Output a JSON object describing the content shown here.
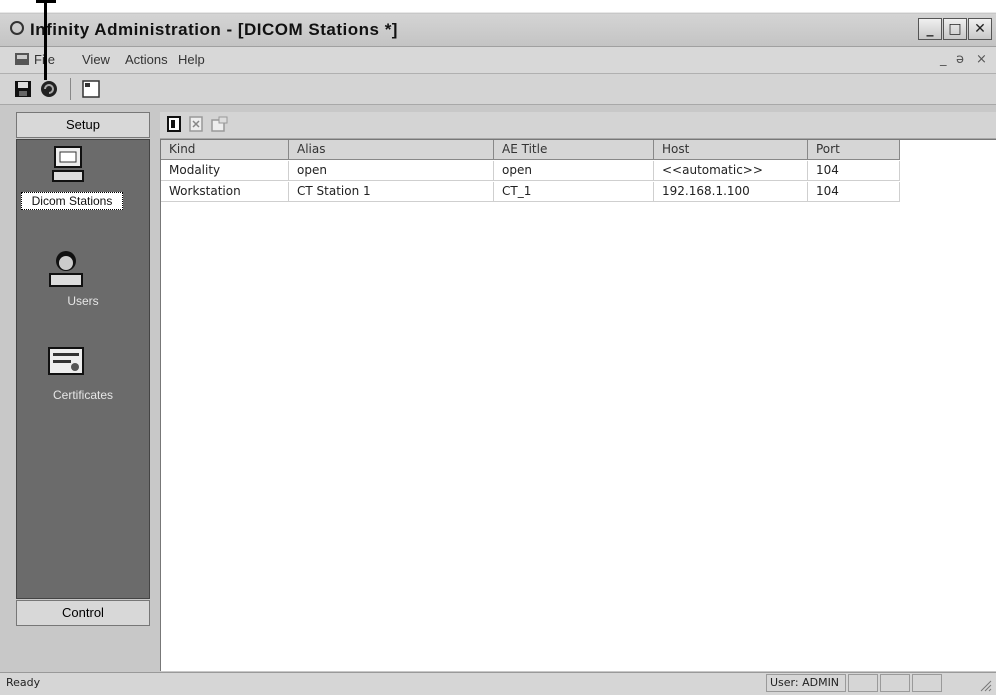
{
  "window": {
    "title": "Infinity Administration - [DICOM Stations *]",
    "controls": [
      "minimize",
      "maximize",
      "close"
    ]
  },
  "menu": {
    "items": [
      "File",
      "View",
      "Actions",
      "Help"
    ],
    "mdi_controls": [
      "_",
      "ə",
      "×"
    ]
  },
  "toolbar": {
    "icons": [
      "save-icon",
      "refresh-icon",
      "window-icon"
    ]
  },
  "sidebar": {
    "top_button": "Setup",
    "bottom_button": "Control",
    "items": [
      {
        "label": "Dicom Stations",
        "icon": "computer-icon",
        "selected": true
      },
      {
        "label": "Users",
        "icon": "user-icon",
        "selected": false
      },
      {
        "label": "Certificates",
        "icon": "certificate-icon",
        "selected": false
      }
    ]
  },
  "list": {
    "toolbar_icons": [
      "new-icon",
      "delete-icon",
      "properties-icon"
    ],
    "columns": [
      "Kind",
      "Alias",
      "AE Title",
      "Host",
      "Port"
    ],
    "rows": [
      [
        "Modality",
        "open",
        "open",
        "<<automatic>>",
        "104"
      ],
      [
        "Workstation",
        "CT Station 1",
        "CT_1",
        "192.168.1.100",
        "104"
      ]
    ]
  },
  "status": {
    "text": "Ready",
    "user": "User: ADMIN"
  },
  "colors": {
    "panel_dark": "#6b6b6b",
    "frame": "#c8c8c8",
    "list_bg": "#ffffff"
  }
}
